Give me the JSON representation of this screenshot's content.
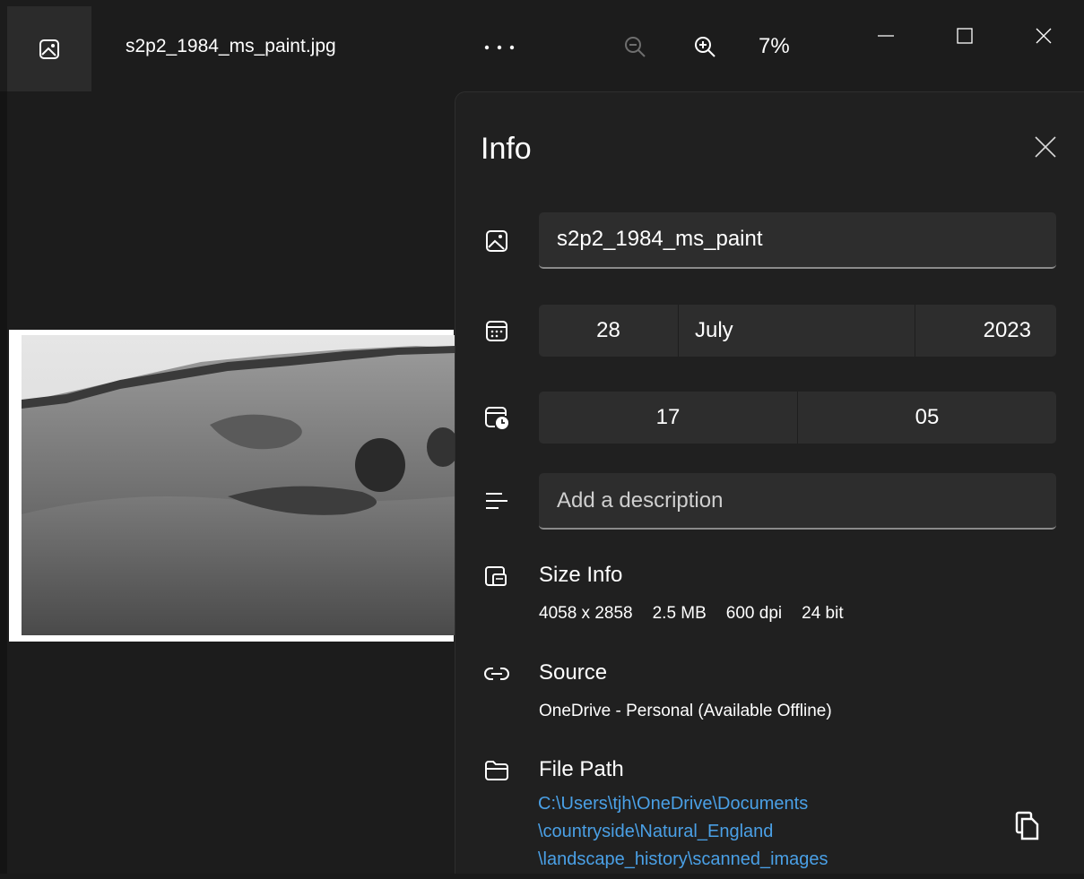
{
  "window": {
    "file_title": "s2p2_1984_ms_paint.jpg",
    "app_icon": "photo-app-icon",
    "more_icon": "more-horizontal-icon",
    "zoom_out_icon": "zoom-out-icon",
    "zoom_in_icon": "zoom-in-icon",
    "zoom_level": "7%",
    "minimize_icon": "minimize-icon",
    "maximize_icon": "maximize-icon",
    "close_icon": "close-icon"
  },
  "info": {
    "title": "Info",
    "close_icon": "close-icon",
    "name": {
      "icon": "image-icon",
      "value": "s2p2_1984_ms_paint"
    },
    "date": {
      "icon": "calendar-icon",
      "day": "28",
      "month": "July",
      "year": "2023"
    },
    "time": {
      "icon": "calendar-clock-icon",
      "hour": "17",
      "minute": "05"
    },
    "description": {
      "icon": "text-align-icon",
      "placeholder": "Add a description"
    },
    "size_info": {
      "icon": "size-info-icon",
      "label": "Size Info",
      "dimensions": "4058 x 2858",
      "file_size": "2.5 MB",
      "dpi": "600 dpi",
      "bit_depth": "24 bit"
    },
    "source": {
      "icon": "link-icon",
      "label": "Source",
      "value": "OneDrive - Personal (Available Offline)"
    },
    "file_path": {
      "icon": "folder-icon",
      "label": "File Path",
      "lines": [
        "C:\\Users\\tjh\\OneDrive\\Documents",
        "\\countryside\\Natural_England",
        "\\landscape_history\\scanned_images"
      ],
      "copy_icon": "copy-icon"
    }
  },
  "colors": {
    "background": "#1c1c1c",
    "panel": "#202020",
    "field": "#2d2d2d",
    "link": "#4aa0e6"
  }
}
